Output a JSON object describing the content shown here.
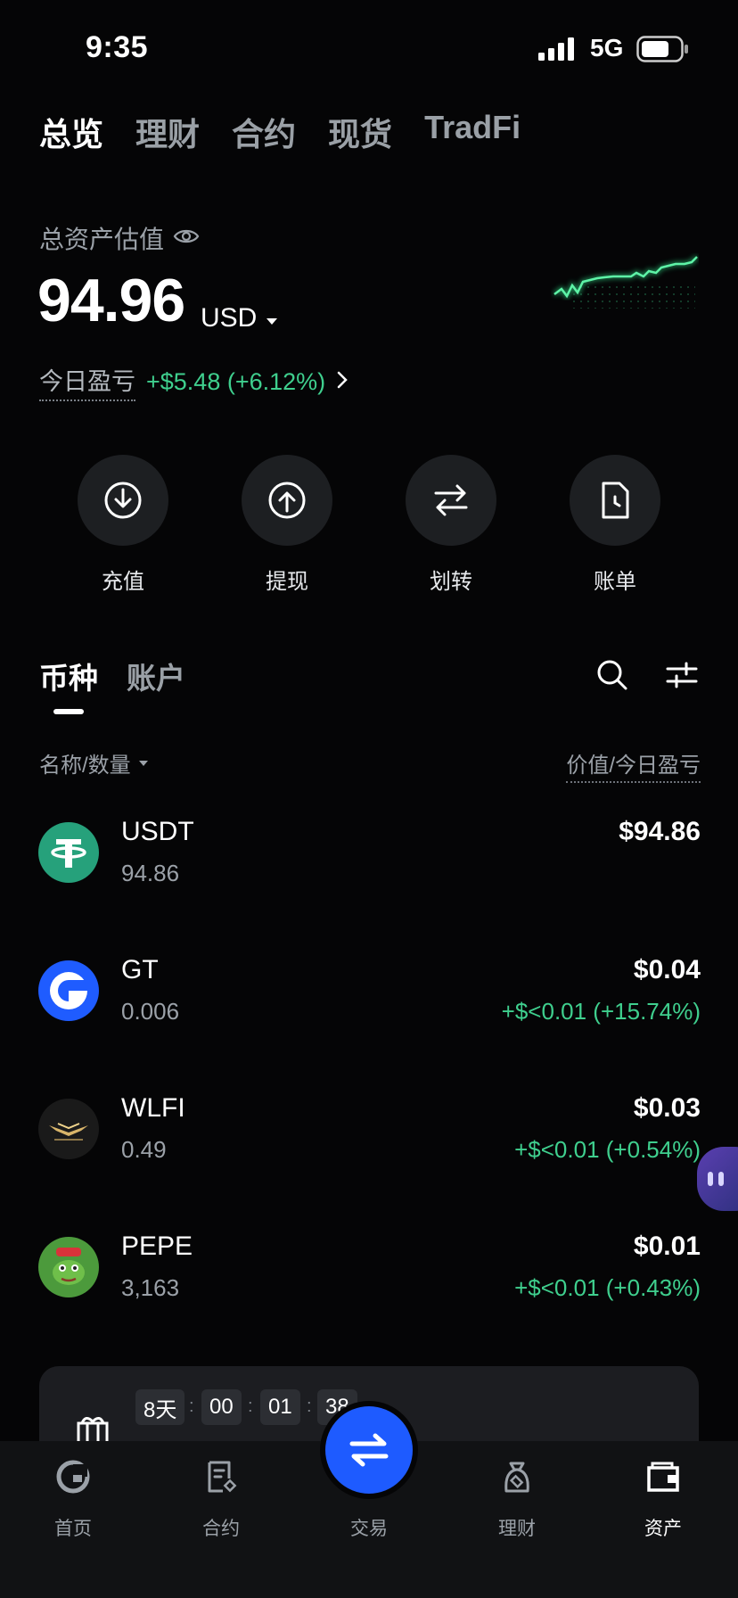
{
  "status_bar": {
    "time": "9:35",
    "network": "5G"
  },
  "top_tabs": [
    "总览",
    "理财",
    "合约",
    "现货",
    "TradFi"
  ],
  "asset": {
    "label": "总资产估值",
    "value": "94.96",
    "unit": "USD",
    "pnl_label": "今日盈亏",
    "pnl_value": "+$5.48 (+6.12%)"
  },
  "actions": [
    {
      "label": "充值",
      "icon": "download-icon"
    },
    {
      "label": "提现",
      "icon": "upload-icon"
    },
    {
      "label": "划转",
      "icon": "transfer-icon"
    },
    {
      "label": "账单",
      "icon": "bill-icon"
    }
  ],
  "coin_tabs": [
    "币种",
    "账户"
  ],
  "list_header": {
    "left": "名称/数量",
    "right": "价值/今日盈亏"
  },
  "coins": [
    {
      "symbol": "USDT",
      "qty": "94.86",
      "value": "$94.86",
      "change": ""
    },
    {
      "symbol": "GT",
      "qty": "0.006",
      "value": "$0.04",
      "change": "+$<0.01 (+15.74%)"
    },
    {
      "symbol": "WLFI",
      "qty": "0.49",
      "value": "$0.03",
      "change": "+$<0.01 (+0.54%)"
    },
    {
      "symbol": "PEPE",
      "qty": "3,163",
      "value": "$0.01",
      "change": "+$<0.01 (+0.43%)"
    }
  ],
  "banner": {
    "days": "8天",
    "hours": "00",
    "minutes": "01",
    "seconds": "38"
  },
  "bottom_nav": [
    {
      "label": "首页",
      "icon": "home-icon"
    },
    {
      "label": "合约",
      "icon": "contract-icon"
    },
    {
      "label": "交易",
      "icon": "trade-icon"
    },
    {
      "label": "理财",
      "icon": "finance-icon"
    },
    {
      "label": "资产",
      "icon": "wallet-icon"
    }
  ],
  "colors": {
    "accent": "#1e5bff",
    "positive": "#3fcf8e",
    "background": "#050506"
  }
}
